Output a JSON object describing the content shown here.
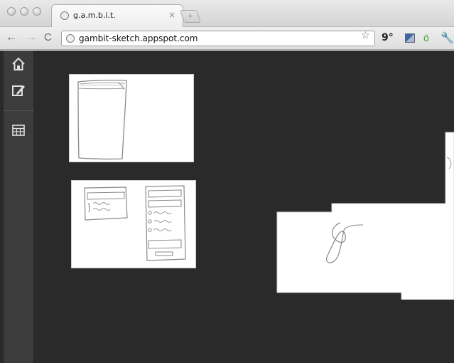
{
  "browser": {
    "tab": {
      "title": "g.a.m.b.i.t.",
      "close_label": "×",
      "favicon": "globe-icon"
    },
    "new_tab_label": "+",
    "nav": {
      "back": "←",
      "forward": "→",
      "reload": "C"
    },
    "address_bar": {
      "url": "gambit-sketch.appspot.com",
      "icon": "globe-icon",
      "star": "☆"
    },
    "extensions": {
      "temperature": "9°",
      "image_ext": "image-icon",
      "android": "ö",
      "wrench": "🔧"
    }
  },
  "app": {
    "sidebar": [
      {
        "name": "home",
        "icon": "home-icon",
        "glyph": "⌂"
      },
      {
        "name": "edit",
        "icon": "edit-icon",
        "glyph": "✎"
      },
      {
        "name": "grid",
        "icon": "grid-icon",
        "glyph": "▦"
      }
    ],
    "canvas_bg": "#2a2a2a",
    "sketches": [
      {
        "name": "sketch-window-thumbnail",
        "content": "hand-drawn window outline"
      },
      {
        "name": "sketch-form-thumbnail",
        "content": "hand-drawn form layout"
      },
      {
        "name": "sketch-large-canvas",
        "content": "hand-drawn curve stroke"
      }
    ]
  }
}
